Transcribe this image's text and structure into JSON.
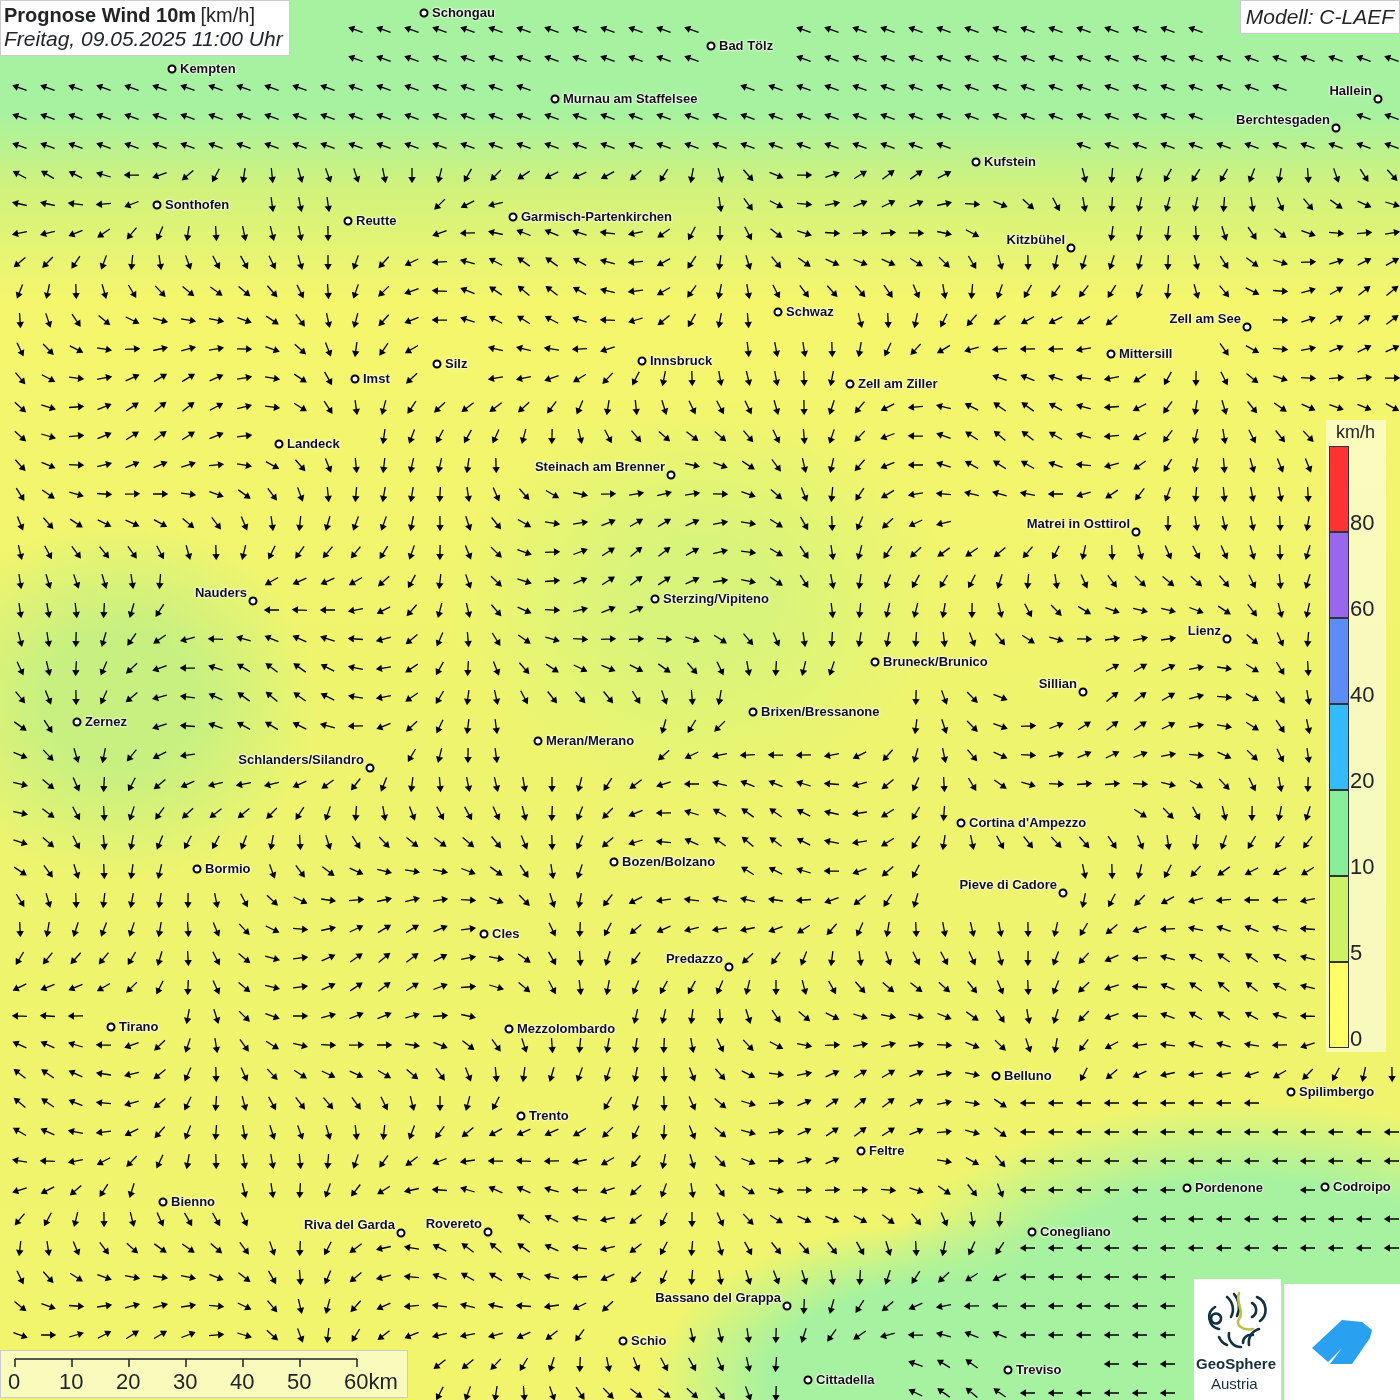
{
  "title": {
    "heading": "Prognose Wind 10m",
    "unit": "[km/h]",
    "date": "Freitag, 09.05.2025 11:00 Uhr"
  },
  "model": "Modell: C-LAEF",
  "cities": [
    {
      "name": "Schongau"
    },
    {
      "name": "Bad Tölz"
    },
    {
      "name": "Kempten"
    },
    {
      "name": "Murnau am Staffelsee"
    },
    {
      "name": "Hallein"
    },
    {
      "name": "Berchtesgaden"
    },
    {
      "name": "Kufstein"
    },
    {
      "name": "Sonthofen"
    },
    {
      "name": "Reutte"
    },
    {
      "name": "Garmisch-Partenkirchen"
    },
    {
      "name": "Kitzbühel"
    },
    {
      "name": "Schwaz"
    },
    {
      "name": "Zell am See"
    },
    {
      "name": "Mittersill"
    },
    {
      "name": "Innsbruck"
    },
    {
      "name": "Silz"
    },
    {
      "name": "Imst"
    },
    {
      "name": "Zell am Ziller"
    },
    {
      "name": "Landeck"
    },
    {
      "name": "Steinach am Brenner"
    },
    {
      "name": "Matrei in Osttirol"
    },
    {
      "name": "Nauders"
    },
    {
      "name": "Sterzing/Vipiteno"
    },
    {
      "name": "Lienz"
    },
    {
      "name": "Bruneck/Brunico"
    },
    {
      "name": "Sillian"
    },
    {
      "name": "Brixen/Bressanone"
    },
    {
      "name": "Zernez"
    },
    {
      "name": "Meran/Merano"
    },
    {
      "name": "Schlanders/Silandro"
    },
    {
      "name": "Cortina d'Ampezzo"
    },
    {
      "name": "Bozen/Bolzano"
    },
    {
      "name": "Bormio"
    },
    {
      "name": "Pieve di Cadore"
    },
    {
      "name": "Cles"
    },
    {
      "name": "Predazzo"
    },
    {
      "name": "Tirano"
    },
    {
      "name": "Mezzolombardo"
    },
    {
      "name": "Belluno"
    },
    {
      "name": "Spilimbergo"
    },
    {
      "name": "Trento"
    },
    {
      "name": "Feltre"
    },
    {
      "name": "Pordenone"
    },
    {
      "name": "Codroipo"
    },
    {
      "name": "Bienno"
    },
    {
      "name": "Riva del Garda"
    },
    {
      "name": "Rovereto"
    },
    {
      "name": "Conegliano"
    },
    {
      "name": "Bassano del Grappa"
    },
    {
      "name": "Schio"
    },
    {
      "name": "Treviso"
    },
    {
      "name": "Cittadella"
    }
  ],
  "legend": {
    "unit": "km/h",
    "bands": [
      {
        "color": "#ff3333",
        "label": "80"
      },
      {
        "color": "#9966ee",
        "label": "60"
      },
      {
        "color": "#5c8cf5",
        "label": "40"
      },
      {
        "color": "#33bbff",
        "label": "20"
      },
      {
        "color": "#88ee99",
        "label": "10"
      },
      {
        "color": "#ccf266",
        "label": "5"
      },
      {
        "color": "#ffff66",
        "label": "0"
      }
    ]
  },
  "scale": {
    "ticks": [
      "0",
      "10",
      "20",
      "30",
      "40",
      "50",
      "60km"
    ]
  },
  "logos": {
    "geosphere": {
      "line1": "GeoSphere",
      "line2": "Austria"
    }
  }
}
